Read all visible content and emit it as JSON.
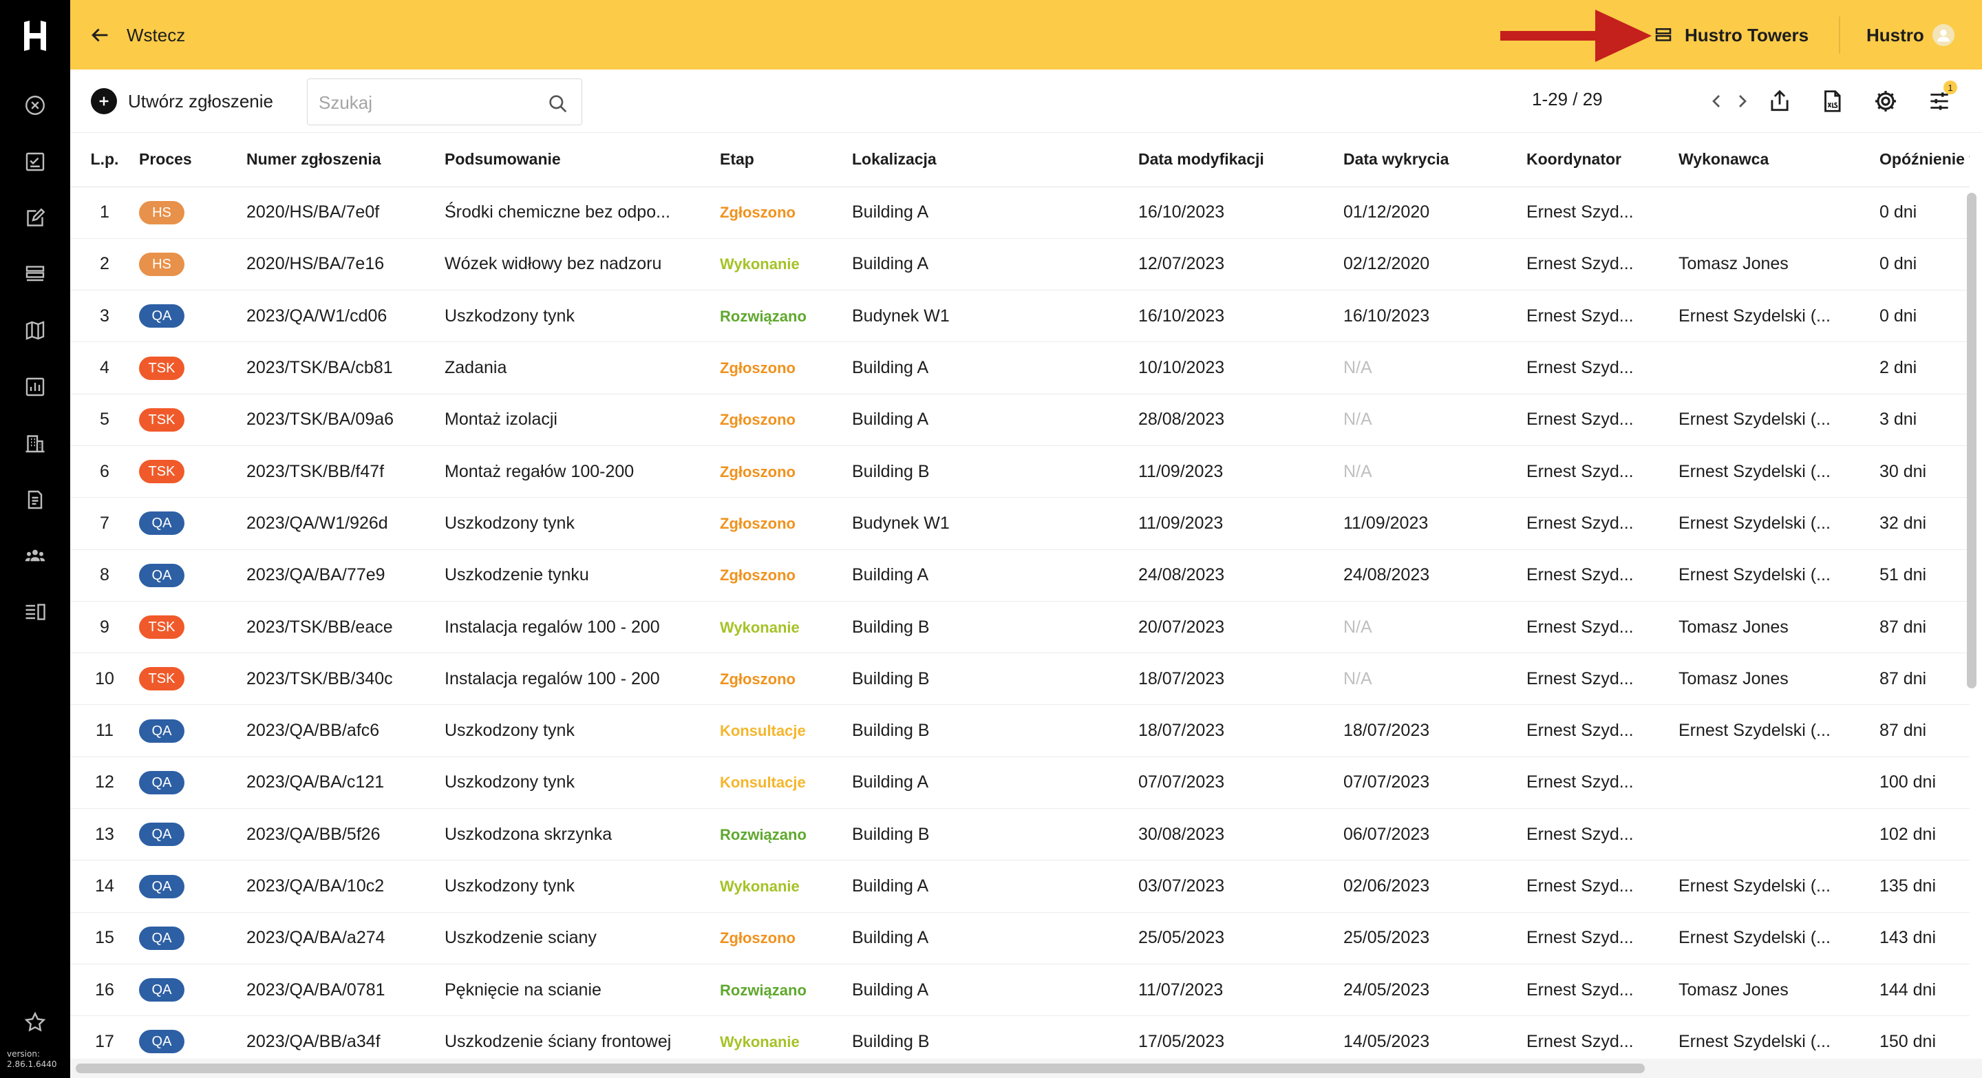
{
  "app": {
    "logo_letter": "H",
    "version_label": "version:",
    "version": "2.86.1.6440"
  },
  "colors": {
    "topbar": "#fccb48",
    "sidebar": "#000000",
    "HS": "#e8914a",
    "QA": "#2d5fa4",
    "TSK": "#f05a2a",
    "Zgłoszono": "#f0921d",
    "Wykonanie": "#a5c227",
    "Rozwiązano": "#5fa82e",
    "Konsultacje": "#f5b62c",
    "annotation_arrow": "#c4201c"
  },
  "sidebar": {
    "items": [
      {
        "icon": "close-circle-icon"
      },
      {
        "icon": "checklist-icon"
      },
      {
        "icon": "edit-icon"
      },
      {
        "icon": "layers-icon"
      },
      {
        "icon": "map-icon"
      },
      {
        "icon": "chart-icon"
      },
      {
        "icon": "building-icon"
      },
      {
        "icon": "document-icon"
      },
      {
        "icon": "users-icon"
      },
      {
        "icon": "list-view-icon"
      },
      {
        "icon": "star-icon"
      }
    ]
  },
  "topbar": {
    "back_label": "Wstecz",
    "project_label": "Hustro Towers",
    "user_label": "Hustro"
  },
  "toolbar": {
    "create_label": "Utwórz zgłoszenie",
    "search_placeholder": "Szukaj",
    "pager": "1-29 / 29",
    "filter_count": "1"
  },
  "table": {
    "headers": [
      "L.p.",
      "Proces",
      "Numer zgłoszenia",
      "Podsumowanie",
      "Etap",
      "Lokalizacja",
      "Data modyfikacji",
      "Data wykrycia",
      "Koordynator",
      "Wykonawca",
      "Opóźnienie te"
    ],
    "rows": [
      [
        "1",
        "HS",
        "2020/HS/BA/7e0f",
        "Środki chemiczne bez odpo...",
        "Zgłoszono",
        "Building A",
        "16/10/2023",
        "01/12/2020",
        "Ernest Szyd...",
        "",
        "0 dni"
      ],
      [
        "2",
        "HS",
        "2020/HS/BA/7e16",
        "Wózek widłowy bez nadzoru",
        "Wykonanie",
        "Building A",
        "12/07/2023",
        "02/12/2020",
        "Ernest Szyd...",
        "Tomasz Jones",
        "0 dni"
      ],
      [
        "3",
        "QA",
        "2023/QA/W1/cd06",
        "Uszkodzony tynk",
        "Rozwiązano",
        "Budynek W1",
        "16/10/2023",
        "16/10/2023",
        "Ernest Szyd...",
        "Ernest Szydelski (...",
        "0 dni"
      ],
      [
        "4",
        "TSK",
        "2023/TSK/BA/cb81",
        "Zadania",
        "Zgłoszono",
        "Building A",
        "10/10/2023",
        "N/A",
        "Ernest Szyd...",
        "",
        "2 dni"
      ],
      [
        "5",
        "TSK",
        "2023/TSK/BA/09a6",
        "Montaż izolacji",
        "Zgłoszono",
        "Building A",
        "28/08/2023",
        "N/A",
        "Ernest Szyd...",
        "Ernest Szydelski (...",
        "3 dni"
      ],
      [
        "6",
        "TSK",
        "2023/TSK/BB/f47f",
        "Montaż regałów 100-200",
        "Zgłoszono",
        "Building B",
        "11/09/2023",
        "N/A",
        "Ernest Szyd...",
        "Ernest Szydelski (...",
        "30 dni"
      ],
      [
        "7",
        "QA",
        "2023/QA/W1/926d",
        "Uszkodzony tynk",
        "Zgłoszono",
        "Budynek W1",
        "11/09/2023",
        "11/09/2023",
        "Ernest Szyd...",
        "Ernest Szydelski (...",
        "32 dni"
      ],
      [
        "8",
        "QA",
        "2023/QA/BA/77e9",
        "Uszkodzenie tynku",
        "Zgłoszono",
        "Building A",
        "24/08/2023",
        "24/08/2023",
        "Ernest Szyd...",
        "Ernest Szydelski (...",
        "51 dni"
      ],
      [
        "9",
        "TSK",
        "2023/TSK/BB/eace",
        "Instalacja regalów 100 - 200",
        "Wykonanie",
        "Building B",
        "20/07/2023",
        "N/A",
        "Ernest Szyd...",
        "Tomasz Jones",
        "87 dni"
      ],
      [
        "10",
        "TSK",
        "2023/TSK/BB/340c",
        "Instalacja regalów 100 - 200",
        "Zgłoszono",
        "Building B",
        "18/07/2023",
        "N/A",
        "Ernest Szyd...",
        "Tomasz Jones",
        "87 dni"
      ],
      [
        "11",
        "QA",
        "2023/QA/BB/afc6",
        "Uszkodzony tynk",
        "Konsultacje",
        "Building B",
        "18/07/2023",
        "18/07/2023",
        "Ernest Szyd...",
        "Ernest Szydelski (...",
        "87 dni"
      ],
      [
        "12",
        "QA",
        "2023/QA/BA/c121",
        "Uszkodzony tynk",
        "Konsultacje",
        "Building A",
        "07/07/2023",
        "07/07/2023",
        "Ernest Szyd...",
        "",
        "100 dni"
      ],
      [
        "13",
        "QA",
        "2023/QA/BB/5f26",
        "Uszkodzona skrzynka",
        "Rozwiązano",
        "Building B",
        "30/08/2023",
        "06/07/2023",
        "Ernest Szyd...",
        "",
        "102 dni"
      ],
      [
        "14",
        "QA",
        "2023/QA/BA/10c2",
        "Uszkodzony tynk",
        "Wykonanie",
        "Building A",
        "03/07/2023",
        "02/06/2023",
        "Ernest Szyd...",
        "Ernest Szydelski (...",
        "135 dni"
      ],
      [
        "15",
        "QA",
        "2023/QA/BA/a274",
        "Uszkodzenie sciany",
        "Zgłoszono",
        "Building A",
        "25/05/2023",
        "25/05/2023",
        "Ernest Szyd...",
        "Ernest Szydelski (...",
        "143 dni"
      ],
      [
        "16",
        "QA",
        "2023/QA/BA/0781",
        "Pęknięcie na scianie",
        "Rozwiązano",
        "Building A",
        "11/07/2023",
        "24/05/2023",
        "Ernest Szyd...",
        "Tomasz Jones",
        "144 dni"
      ],
      [
        "17",
        "QA",
        "2023/QA/BB/a34f",
        "Uszkodzenie ściany frontowej",
        "Wykonanie",
        "Building B",
        "17/05/2023",
        "14/05/2023",
        "Ernest Szyd...",
        "Ernest Szydelski (...",
        "150 dni"
      ]
    ]
  }
}
